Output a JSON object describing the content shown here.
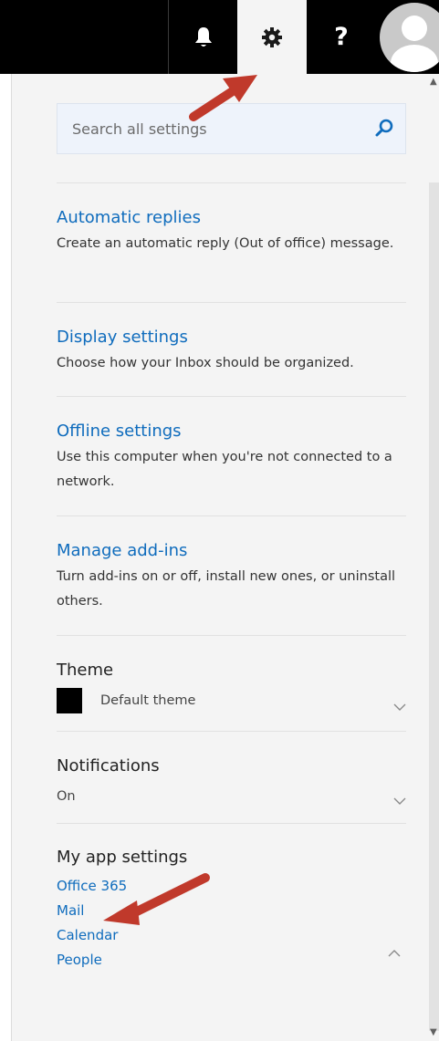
{
  "colors": {
    "topbar": "#000000",
    "panel": "#f4f4f4",
    "link": "#0f6cbd",
    "annotation_arrow": "#c0392b"
  },
  "header": {
    "notifications_icon": "bell-icon",
    "settings_icon": "gear-icon",
    "help_icon": "help-icon",
    "help_glyph": "?",
    "avatar_icon": "user-avatar-icon"
  },
  "search": {
    "placeholder": "Search all settings",
    "icon": "search-icon"
  },
  "options": [
    {
      "title": "Automatic replies",
      "description": "Create an automatic reply (Out of office) message."
    },
    {
      "title": "Display settings",
      "description": "Choose how your Inbox should be organized."
    },
    {
      "title": "Offline settings",
      "description": "Use this computer when you're not connected to a network."
    },
    {
      "title": "Manage add-ins",
      "description": "Turn add-ins on or off, install new ones, or uninstall others."
    }
  ],
  "theme": {
    "heading": "Theme",
    "value": "Default theme",
    "swatch_color": "#000000"
  },
  "notifications": {
    "heading": "Notifications",
    "value": "On"
  },
  "app_settings": {
    "heading": "My app settings",
    "links": [
      "Office 365",
      "Mail",
      "Calendar",
      "People"
    ]
  }
}
